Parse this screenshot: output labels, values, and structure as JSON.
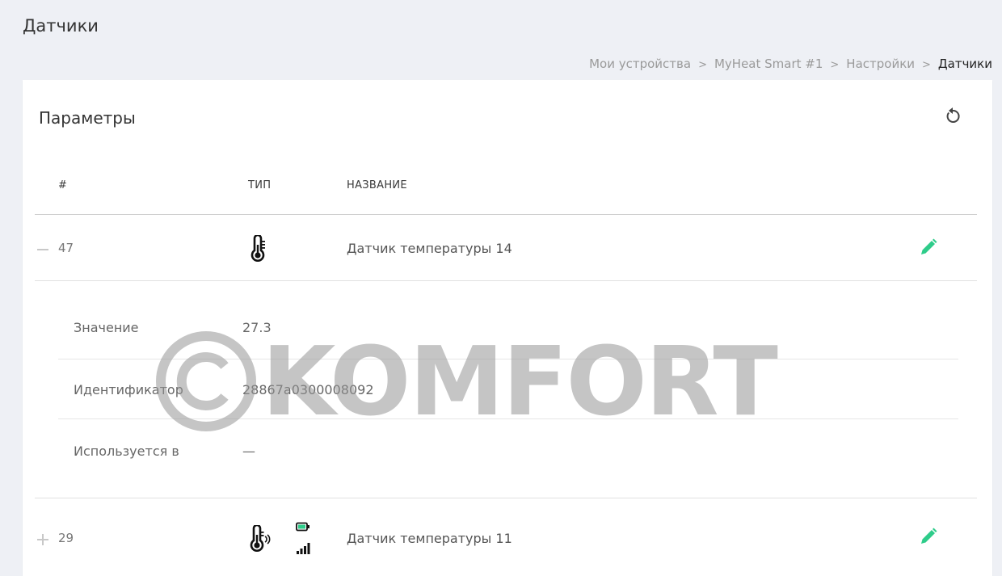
{
  "page": {
    "title": "Датчики",
    "breadcrumb": [
      {
        "label": "Мои устройства"
      },
      {
        "label": "MyHeat Smart #1"
      },
      {
        "label": "Настройки"
      },
      {
        "label": "Датчики"
      }
    ],
    "breadcrumb_separator": ">"
  },
  "card": {
    "title": "Параметры",
    "refresh_icon": "refresh-icon"
  },
  "table": {
    "columns": [
      "#",
      "ТИП",
      "НАЗВАНИЕ"
    ],
    "rows": [
      {
        "number": "47",
        "expanded": true,
        "type_icon": "thermometer-icon",
        "name": "Датчик температуры 14",
        "details": [
          {
            "label": "Значение",
            "value": "27.3"
          },
          {
            "label": "Идентификатор",
            "value": "28867a0300008092"
          },
          {
            "label": "Используется в",
            "value": "—"
          }
        ]
      },
      {
        "number": "29",
        "expanded": false,
        "type_icon": "wireless-thermometer-icon",
        "battery_icon": "battery-icon",
        "signal_icon": "signal-icon",
        "name": "Датчик температуры 11"
      }
    ]
  },
  "watermark": {
    "text": "KOMFORT"
  },
  "colors": {
    "background": "#eef0f5",
    "accent": "#2ecc8a",
    "text": "#555555"
  }
}
